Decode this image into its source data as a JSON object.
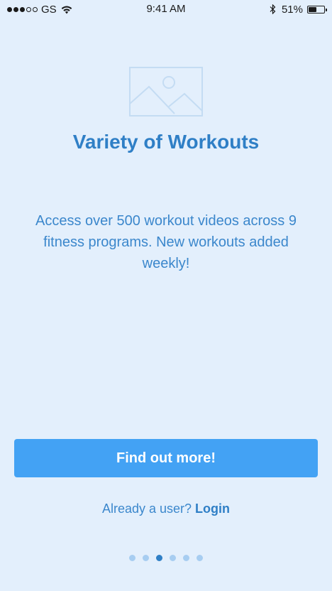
{
  "status_bar": {
    "signal_filled": 3,
    "signal_total": 5,
    "carrier": "GS",
    "time": "9:41 AM",
    "battery_percent_label": "51%",
    "battery_level": 0.51,
    "icons": [
      "wifi-icon",
      "bluetooth-icon",
      "battery-icon"
    ]
  },
  "onboarding": {
    "image_icon": "image-placeholder-icon",
    "title": "Variety of Workouts",
    "description": "Access over 500 workout videos across 9 fitness programs. New workouts added weekly!",
    "cta_label": "Find out more!",
    "login_prompt": "Already a user?",
    "login_link": "Login"
  },
  "pagination": {
    "total": 6,
    "active_index": 2
  },
  "colors": {
    "background": "#e3effc",
    "accent": "#43a2f4",
    "title": "#2f7fc6",
    "text": "#3b87cc",
    "dot_inactive": "#a7cdf1"
  }
}
